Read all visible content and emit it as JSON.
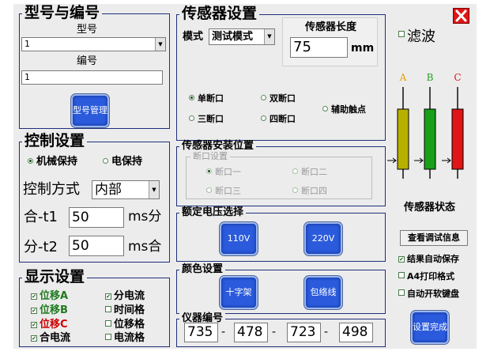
{
  "model": {
    "title": "型号与编号",
    "model_label": "型号",
    "model_value": "1",
    "number_label": "编号",
    "number_value": "1",
    "manage_button": "型号管理"
  },
  "control": {
    "title": "控制设置",
    "radio_mechanical": "机械保持",
    "radio_electric": "电保持",
    "mode_label": "控制方式",
    "mode_value": "内部",
    "open_label": "合-t1",
    "open_value": "50",
    "open_unit": "ms分",
    "close_label": "分-t2",
    "close_value": "50",
    "close_unit": "ms合"
  },
  "display": {
    "title": "显示设置",
    "items": [
      {
        "label": "位移A",
        "checked": true,
        "color": "#1f7a1f"
      },
      {
        "label": "分电流",
        "checked": true,
        "color": "#000000"
      },
      {
        "label": "位移B",
        "checked": true,
        "color": "#1f7a1f"
      },
      {
        "label": "时间格",
        "checked": false,
        "color": "#000000"
      },
      {
        "label": "位移C",
        "checked": true,
        "color": "#cc0000"
      },
      {
        "label": "位移格",
        "checked": false,
        "color": "#000000"
      },
      {
        "label": "合电流",
        "checked": true,
        "color": "#000000"
      },
      {
        "label": "电流格",
        "checked": false,
        "color": "#000000"
      }
    ]
  },
  "sensor": {
    "title": "传感器设置",
    "mode_label": "模式",
    "mode_value": "测试模式",
    "length_title": "传感器长度",
    "length_value": "75",
    "length_unit": "mm",
    "break_single": "单断口",
    "break_double": "双断口",
    "break_aux": "辅助触点",
    "break_triple": "三断口",
    "break_quad": "四断口"
  },
  "install": {
    "title": "传感器安装位置",
    "sub_title": "断口设置",
    "b1": "断口一",
    "b2": "断口二",
    "b3": "断口三",
    "b4": "断口四"
  },
  "voltage": {
    "title": "额定电压选择",
    "v110": "110V",
    "v220": "220V"
  },
  "color": {
    "title": "颜色设置",
    "cross": "十字架",
    "envelope": "包络线"
  },
  "instrument": {
    "title": "仪器编号",
    "parts": [
      "735",
      "478",
      "723",
      "498"
    ],
    "sep": "-"
  },
  "right": {
    "filter_label": "滤波",
    "phase_a": "A",
    "phase_b": "B",
    "phase_c": "C",
    "phase_a_color": "#e8a000",
    "phase_b_color": "#1f9e1f",
    "phase_c_color": "#e01010",
    "sensor_state": "传感器状态",
    "view_debug": "查看调试信息",
    "auto_save": "结果自动保存",
    "auto_save_checked": true,
    "a4_print": "A4打印格式",
    "a4_print_checked": false,
    "auto_keyboard": "自动开软键盘",
    "auto_keyboard_checked": false,
    "finish_button": "设置完成"
  }
}
